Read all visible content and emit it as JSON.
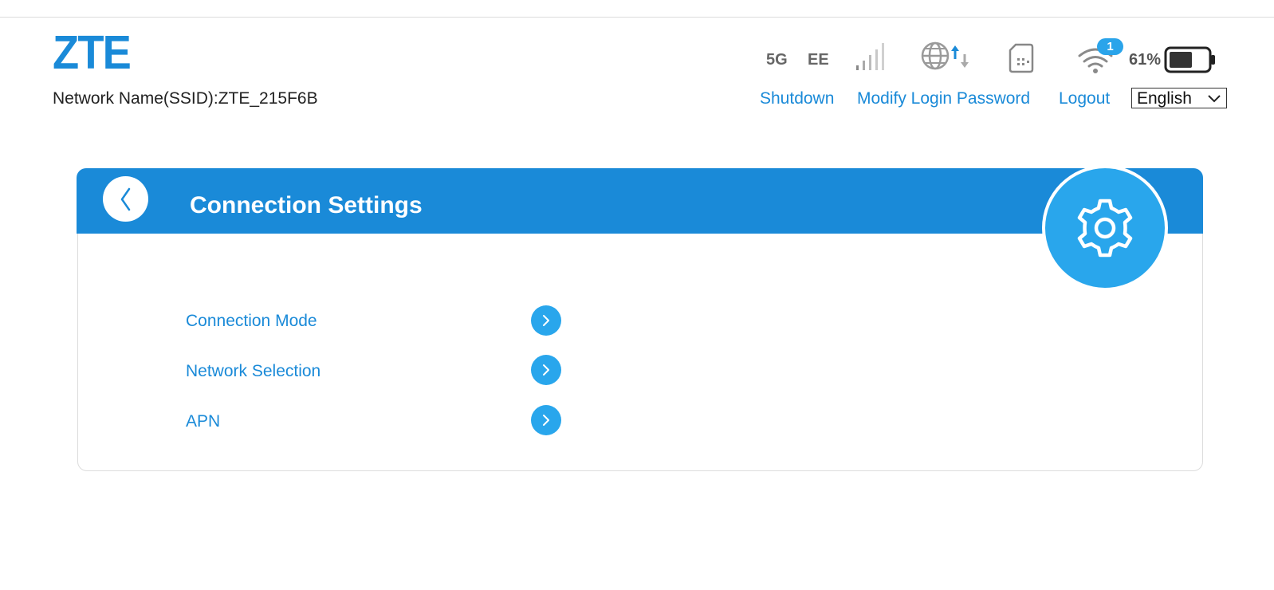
{
  "header": {
    "logo_text": "ZTE",
    "ssid_text": "Network Name(SSID):ZTE_215F6B"
  },
  "status": {
    "network_type": "5G",
    "operator": "EE",
    "signal_icon": "signal-bars-icon",
    "data_icon": "globe-data-transfer-icon",
    "sim_icon": "sim-card-icon",
    "wifi_icon": "wifi-icon",
    "wifi_clients": "1",
    "battery_percent": "61%",
    "battery_level": 0.61
  },
  "top_links": {
    "shutdown": "Shutdown",
    "modify_password": "Modify Login Password",
    "logout": "Logout"
  },
  "language": {
    "selected": "English"
  },
  "panel": {
    "title": "Connection Settings",
    "back_icon": "chevron-left-icon",
    "badge_icon": "gear-icon",
    "items": [
      {
        "label": "Connection Mode"
      },
      {
        "label": "Network Selection"
      },
      {
        "label": "APN"
      }
    ]
  },
  "colors": {
    "accent": "#1a8ad8",
    "accent_light": "#29a6ec",
    "text": "#222222"
  }
}
